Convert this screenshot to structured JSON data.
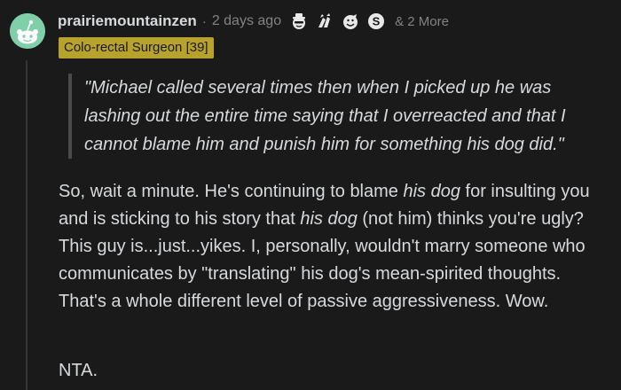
{
  "comment": {
    "username": "prairiemountainzen",
    "separator": "·",
    "timestamp": "2 days ago",
    "awards": [
      {
        "icon": "hat-face-award-icon"
      },
      {
        "icon": "hands-award-icon"
      },
      {
        "icon": "face-award-icon"
      },
      {
        "icon": "silver-coin-award-icon"
      }
    ],
    "more_awards": "& 2 More",
    "flair": {
      "text": "Colo-rectal Surgeon [39]",
      "color": "#b8a22e"
    },
    "quote": "\"Michael called several times then when I picked up he was lashing out the entire time saying that I overreacted and that I cannot blame him and punish him for something his dog did.\"",
    "body": {
      "part1": "So, wait a minute. He's continuing to blame ",
      "em1": "his dog",
      "part2": " for insulting you and is sticking to his story that ",
      "em2": "his dog",
      "part3": " (not him) thinks you're ugly? This guy is...just...yikes. I, personally, wouldn't marry someone who communicates by \"translating\" his dog's mean-spirited thoughts. That's a whole different level of passive aggressiveness. Wow."
    },
    "verdict": "NTA."
  },
  "colors": {
    "background": "#1a1a1b",
    "text": "#d7dadc",
    "muted": "#818384",
    "avatar": "#7fd0a8"
  }
}
